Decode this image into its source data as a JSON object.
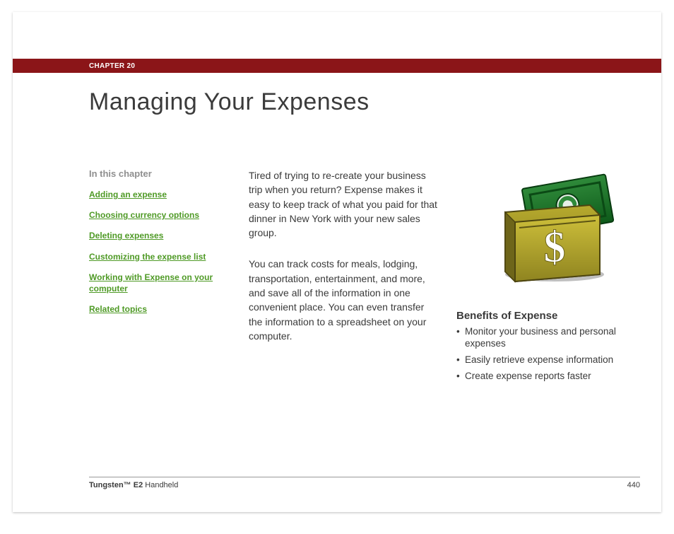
{
  "chapter_label": "CHAPTER 20",
  "title": "Managing Your Expenses",
  "sidebar": {
    "heading": "In this chapter",
    "links": [
      "Adding an expense",
      "Choosing currency options",
      "Deleting expenses",
      "Customizing the expense list",
      "Working with Expense on your computer",
      "Related topics"
    ]
  },
  "body": {
    "para1": "Tired of trying to re-create your business trip when you return? Expense makes it easy to keep track of what you paid for that dinner in New York with your new sales group.",
    "para2": "You can track costs for meals, lodging, transportation, entertainment, and more, and save all of the information in one convenient place. You can even transfer the information to a spreadsheet on your computer."
  },
  "benefits": {
    "heading": "Benefits of Expense",
    "items": [
      "Monitor your business and personal expenses",
      "Easily retrieve expense information",
      "Create expense reports faster"
    ]
  },
  "footer": {
    "product_bold": "Tungsten™ E2",
    "product_rest": " Handheld",
    "page_number": "440"
  }
}
